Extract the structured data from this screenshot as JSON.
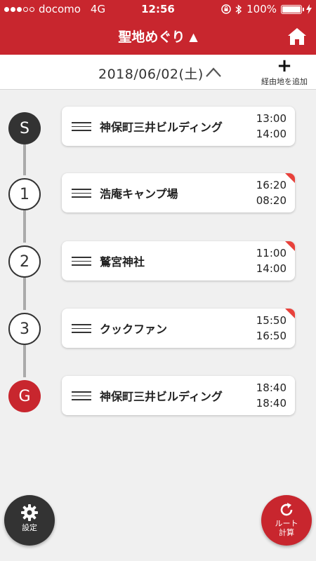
{
  "status_bar": {
    "carrier": "docomo",
    "network": "4G",
    "time": "12:56",
    "battery": "100%"
  },
  "nav": {
    "title": "聖地めぐり",
    "title_toggle_icon": "triangle-up-icon",
    "home_icon": "home-icon"
  },
  "date_bar": {
    "date": "2018/06/02(土)",
    "collapse_icon": "chevron-up-icon",
    "add_via_label": "経由地を追加",
    "add_icon": "plus-icon"
  },
  "stops": [
    {
      "marker": "S",
      "name": "神保町三井ビルディング",
      "time1": "13:00",
      "time2": "14:00",
      "flag": false
    },
    {
      "marker": "1",
      "name": "浩庵キャンプ場",
      "time1": "16:20",
      "time2": "08:20",
      "flag": true
    },
    {
      "marker": "2",
      "name": "鷲宮神社",
      "time1": "11:00",
      "time2": "14:00",
      "flag": true
    },
    {
      "marker": "3",
      "name": "クックファン",
      "time1": "15:50",
      "time2": "16:50",
      "flag": true
    },
    {
      "marker": "G",
      "name": "神保町三井ビルディング",
      "time1": "18:40",
      "time2": "18:40",
      "flag": false
    }
  ],
  "buttons": {
    "settings_label": "設定",
    "route_label_line1": "ルート",
    "route_label_line2": "計算"
  },
  "colors": {
    "primary": "#c8262e",
    "dark": "#333333",
    "flag": "#e8413b"
  }
}
